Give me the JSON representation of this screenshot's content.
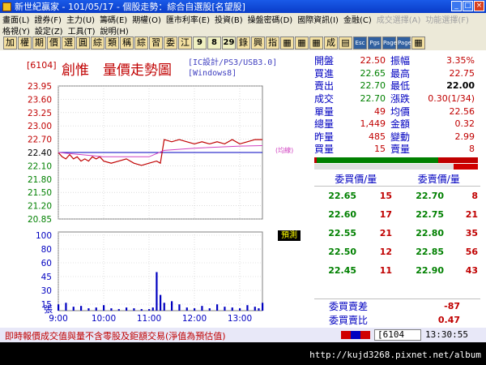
{
  "window": {
    "title": "新世紀贏家 - 101/05/17 - 個股走勢：綜合自選股[名望股]",
    "min": "_",
    "max": "□",
    "close": "×"
  },
  "menu1": [
    "畫面(L)",
    "證券(F)",
    "主力(U)",
    "籌碼(E)",
    "期權(O)",
    "匯市利率(E)",
    "投資(B)",
    "操盤密碼(D)",
    "國際資訊(I)",
    "金融(C)",
    "成交選擇(A)",
    "功能選擇(F)"
  ],
  "menu2": [
    "格視(Y)",
    "設定(Z)",
    "工具(T)",
    "說明(H)"
  ],
  "toolbar": [
    "加",
    "權",
    "期",
    "價",
    "選",
    "圓",
    "綜",
    "類",
    "稱",
    "綜",
    "習",
    "委",
    "江",
    "9",
    "8",
    "29",
    "錄",
    "興",
    "指",
    "▦",
    "▦",
    "▦",
    "成",
    "▤",
    "Esc",
    "Pgs",
    "Page",
    "Page",
    "▦"
  ],
  "chart_meta": {
    "code": "6104",
    "name": "創惟",
    "title": "量價走勢圖",
    "source1": "[IC設計/PS3/USB3.0]",
    "source2": "[Windows8]",
    "avg_tag": "(均線)",
    "vol_tag": "預測"
  },
  "chart_data": {
    "type": "line",
    "title": "量價走勢圖",
    "price_axis": {
      "ticks": [
        "23.95",
        "23.60",
        "23.25",
        "23.00",
        "22.70",
        "22.40",
        "22.10",
        "21.80",
        "21.50",
        "21.20",
        "20.85"
      ],
      "reference": 22.4,
      "ylim": [
        20.85,
        23.95
      ]
    },
    "volume_axis": {
      "ticks": [
        "100",
        "80",
        "60",
        "45",
        "30",
        "15"
      ],
      "unit": "張",
      "ylim": [
        0,
        100
      ]
    },
    "x_ticks": [
      "9:00",
      "10:00",
      "11:00",
      "12:00",
      "13:00"
    ],
    "series": [
      {
        "name": "price",
        "x": [
          "9:00",
          "9:05",
          "9:10",
          "9:15",
          "9:20",
          "9:25",
          "9:30",
          "9:35",
          "9:40",
          "9:45",
          "9:50",
          "9:55",
          "10:00",
          "10:10",
          "10:20",
          "10:30",
          "10:40",
          "10:50",
          "11:00",
          "11:10",
          "11:15",
          "11:20",
          "11:30",
          "11:40",
          "11:50",
          "12:00",
          "12:10",
          "12:20",
          "12:30",
          "12:40",
          "12:50",
          "13:00",
          "13:10",
          "13:20",
          "13:30"
        ],
        "values": [
          22.4,
          22.3,
          22.25,
          22.35,
          22.25,
          22.3,
          22.2,
          22.25,
          22.2,
          22.3,
          22.25,
          22.3,
          22.2,
          22.15,
          22.2,
          22.25,
          22.15,
          22.1,
          22.15,
          22.2,
          22.15,
          22.7,
          22.65,
          22.7,
          22.65,
          22.6,
          22.65,
          22.6,
          22.65,
          22.6,
          22.7,
          22.6,
          22.65,
          22.7,
          22.7
        ]
      },
      {
        "name": "average",
        "x": [
          "9:00",
          "10:00",
          "11:00",
          "11:20",
          "12:00",
          "13:00",
          "13:30"
        ],
        "values": [
          22.4,
          22.3,
          22.3,
          22.45,
          22.5,
          22.55,
          22.56
        ]
      }
    ],
    "volume": {
      "x": [
        "9:00",
        "9:10",
        "9:20",
        "9:30",
        "9:40",
        "9:50",
        "10:00",
        "10:10",
        "10:20",
        "10:30",
        "10:40",
        "10:50",
        "11:00",
        "11:05",
        "11:10",
        "11:15",
        "11:20",
        "11:30",
        "11:40",
        "11:50",
        "12:00",
        "12:10",
        "12:20",
        "12:30",
        "12:40",
        "12:50",
        "13:00",
        "13:10",
        "13:20",
        "13:25",
        "13:30"
      ],
      "values": [
        8,
        10,
        5,
        6,
        3,
        4,
        7,
        3,
        2,
        4,
        3,
        2,
        2,
        4,
        49,
        20,
        10,
        12,
        8,
        4,
        3,
        6,
        3,
        8,
        5,
        4,
        3,
        7,
        5,
        3,
        10
      ]
    },
    "grid": true
  },
  "quote": [
    [
      "開盤",
      "22.50",
      "振幅",
      "3.35%"
    ],
    [
      "買進",
      "22.65",
      "最高",
      "22.75"
    ],
    [
      "賣出",
      "22.70",
      "最低",
      "22.00"
    ],
    [
      "成交",
      "22.70",
      "漲跌",
      "0.30(1/34)"
    ],
    [
      "單量",
      "49",
      "均價",
      "22.56"
    ],
    [
      "總量",
      "1,449",
      "金額",
      "0.32"
    ],
    [
      "昨量",
      "485",
      "變動",
      "2.99"
    ],
    [
      "買量",
      "15",
      "賣量",
      "8"
    ]
  ],
  "book": {
    "bid_header": "委買價/量",
    "ask_header": "委賣價/量",
    "rows": [
      [
        "22.65",
        "15",
        "22.70",
        "8"
      ],
      [
        "22.60",
        "17",
        "22.75",
        "21"
      ],
      [
        "22.55",
        "21",
        "22.80",
        "35"
      ],
      [
        "22.50",
        "12",
        "22.85",
        "56"
      ],
      [
        "22.45",
        "11",
        "22.90",
        "43"
      ]
    ],
    "diff_label": "委買賣差",
    "diff_value": "-87",
    "ratio_label": "委買賣比",
    "ratio_value": "0.47"
  },
  "status": {
    "text": "即時報價成交值與量不含零股及鉅額交易(淨值為預估值)",
    "code": "6104",
    "time": "13:30:55"
  },
  "watermark": "http://kujd3268.pixnet.net/album",
  "colors": {
    "price_line": "#c00000",
    "avg_line": "#d040c0",
    "reference_line": "#0000c0",
    "volume_bar": "#0000c0",
    "grid": "#c8c8c8"
  }
}
